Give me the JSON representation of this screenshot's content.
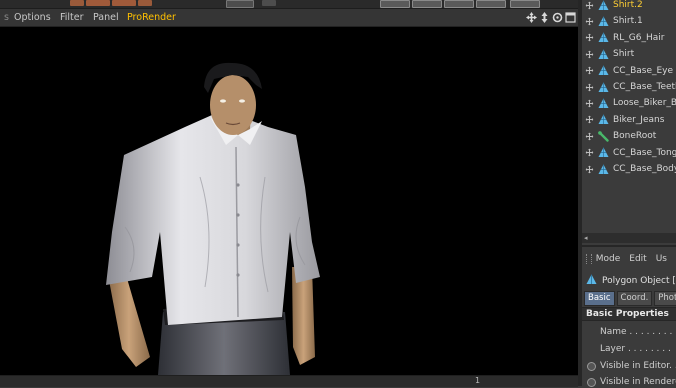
{
  "viewport": {
    "menu": [
      {
        "label": "Options",
        "active": false
      },
      {
        "label": "Filter",
        "active": false
      },
      {
        "label": "Panel",
        "active": false
      },
      {
        "label": "ProRender",
        "active": true
      }
    ],
    "nav_icons": [
      "move-icon",
      "zoom-icon",
      "rotate-icon",
      "maximize-icon"
    ],
    "status_readout": "1"
  },
  "object_manager": {
    "objects": [
      {
        "label": "Shirt.2",
        "icon": "polygon-object-icon",
        "selected": true
      },
      {
        "label": "Shirt.1",
        "icon": "polygon-object-icon",
        "selected": false
      },
      {
        "label": "RL_G6_Hair",
        "icon": "polygon-object-icon",
        "selected": false
      },
      {
        "label": "Shirt",
        "icon": "polygon-object-icon",
        "selected": false
      },
      {
        "label": "CC_Base_Eye",
        "icon": "polygon-object-icon",
        "selected": false
      },
      {
        "label": "CC_Base_Teeth",
        "icon": "polygon-object-icon",
        "selected": false
      },
      {
        "label": "Loose_Biker_Bo",
        "icon": "polygon-object-icon",
        "selected": false
      },
      {
        "label": "Biker_Jeans",
        "icon": "polygon-object-icon",
        "selected": false
      },
      {
        "label": "BoneRoot",
        "icon": "joint-icon",
        "selected": false
      },
      {
        "label": "CC_Base_Tongu",
        "icon": "polygon-object-icon",
        "selected": false
      },
      {
        "label": "CC_Base_Body",
        "icon": "polygon-object-icon",
        "selected": false
      }
    ]
  },
  "attribute_manager": {
    "menu": [
      "Mode",
      "Edit",
      "Us"
    ],
    "object_title": "Polygon Object [",
    "tabs": [
      {
        "label": "Basic",
        "active": true
      },
      {
        "label": "Coord.",
        "active": false
      },
      {
        "label": "Phot",
        "active": false
      }
    ],
    "section_title": "Basic Properties",
    "properties": [
      {
        "label": "Name . . . . . . . .",
        "has_radio": false
      },
      {
        "label": "Layer . . . . . . . .",
        "has_radio": false
      },
      {
        "label": "Visible in Editor. .",
        "has_radio": true
      },
      {
        "label": "Visible in Rendere",
        "has_radio": true
      }
    ]
  },
  "colors": {
    "selected_object": "#ffcf33",
    "prorender_menu": "#ffc000",
    "polygon_icon": "#5bb8e8",
    "joint_icon": "#49b86a",
    "active_tab": "#5a6f8c"
  }
}
